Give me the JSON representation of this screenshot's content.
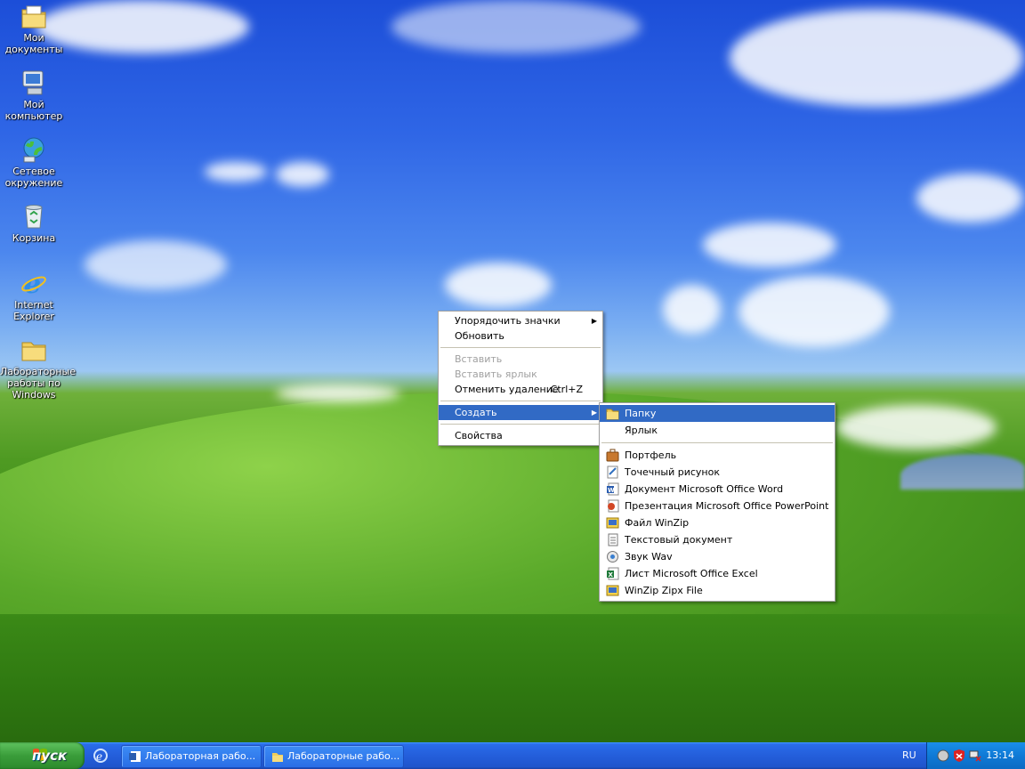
{
  "desktop": {
    "icons": [
      {
        "label": "Мои документы",
        "icon": "my-documents-icon"
      },
      {
        "label": "Мой компьютер",
        "icon": "my-computer-icon"
      },
      {
        "label": "Сетевое окружение",
        "icon": "network-places-icon"
      },
      {
        "label": "Корзина",
        "icon": "recycle-bin-icon"
      },
      {
        "label": "Internet Explorer",
        "icon": "internet-explorer-icon"
      },
      {
        "label": "Лабораторные работы по Windows",
        "icon": "folder-icon"
      }
    ]
  },
  "context_menu": {
    "items": [
      {
        "label": "Упорядочить значки",
        "has_submenu": true
      },
      {
        "label": "Обновить"
      },
      {
        "label": "Вставить",
        "disabled": true
      },
      {
        "label": "Вставить ярлык",
        "disabled": true
      },
      {
        "label": "Отменить удаление",
        "shortcut": "Ctrl+Z"
      },
      {
        "label": "Создать",
        "has_submenu": true,
        "highlighted": true
      },
      {
        "label": "Свойства"
      }
    ]
  },
  "submenu": {
    "items": [
      {
        "label": "Папку",
        "icon": "folder-icon",
        "highlighted": true
      },
      {
        "label": "Ярлык",
        "icon": "shortcut-icon"
      },
      {
        "label": "Портфель",
        "icon": "briefcase-icon"
      },
      {
        "label": "Точечный рисунок",
        "icon": "bitmap-icon"
      },
      {
        "label": "Документ Microsoft Office Word",
        "icon": "word-doc-icon"
      },
      {
        "label": "Презентация Microsoft Office PowerPoint",
        "icon": "powerpoint-icon"
      },
      {
        "label": "Файл WinZip",
        "icon": "winzip-icon"
      },
      {
        "label": "Текстовый документ",
        "icon": "text-doc-icon"
      },
      {
        "label": "Звук Wav",
        "icon": "wav-sound-icon"
      },
      {
        "label": "Лист Microsoft Office Excel",
        "icon": "excel-icon"
      },
      {
        "label": "WinZip Zipx File",
        "icon": "winzip-zipx-icon"
      }
    ]
  },
  "taskbar": {
    "start_label": "пуск",
    "buttons": [
      {
        "label": "Лабораторная рабо...",
        "icon": "word-doc-icon"
      },
      {
        "label": "Лабораторные рабо...",
        "icon": "folder-icon"
      }
    ],
    "language": "RU",
    "clock": "13:14"
  },
  "colors": {
    "menu_highlight": "#316ac5",
    "taskbar_blue": "#245edb",
    "start_green": "#3a9d3a"
  }
}
